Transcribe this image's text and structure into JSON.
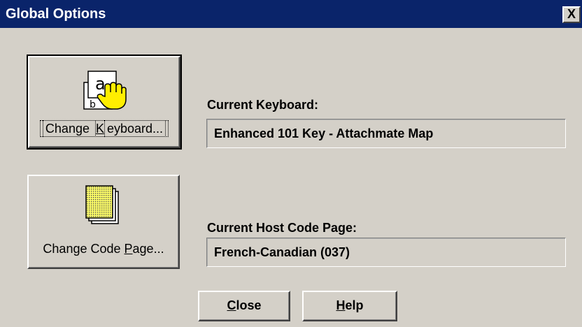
{
  "window": {
    "title": "Global Options",
    "close_glyph": "X"
  },
  "keyboard": {
    "button_prefix": "Change ",
    "button_mnemonic": "K",
    "button_suffix": "eyboard...",
    "icon": "keyboard-hand-icon",
    "label": "Current Keyboard:",
    "value": "Enhanced 101 Key - Attachmate Map"
  },
  "code_page": {
    "button_prefix": "Change Code ",
    "button_mnemonic": "P",
    "button_suffix": "age...",
    "icon": "code-page-icon",
    "label": "Current Host Code Page:",
    "value": "French-Canadian (037)"
  },
  "buttons": {
    "close_mnemonic": "C",
    "close_rest": "lose",
    "help_mnemonic": "H",
    "help_rest": "elp"
  },
  "colors": {
    "title_bar": "#0a246a",
    "face": "#d4d0c8",
    "icon_yellow": "#ffff66"
  }
}
